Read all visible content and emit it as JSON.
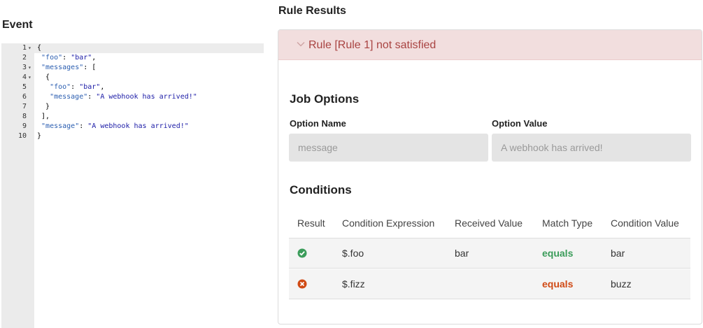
{
  "event": {
    "title": "Event",
    "lines": [
      {
        "n": "1",
        "fold": true,
        "text": "{"
      },
      {
        "n": "2",
        "fold": false,
        "key": "\"foo\"",
        "sep": ": ",
        "val": "\"bar\"",
        "tail": ",",
        "indent": " "
      },
      {
        "n": "3",
        "fold": true,
        "key": "\"messages\"",
        "sep": ": ",
        "val": "",
        "tail": "[",
        "indent": " "
      },
      {
        "n": "4",
        "fold": true,
        "text": "  {"
      },
      {
        "n": "5",
        "fold": false,
        "key": "\"foo\"",
        "sep": ": ",
        "val": "\"bar\"",
        "tail": ",",
        "indent": "   "
      },
      {
        "n": "6",
        "fold": false,
        "key": "\"message\"",
        "sep": ": ",
        "val": "\"A webhook has arrived!\"",
        "tail": "",
        "indent": "   "
      },
      {
        "n": "7",
        "fold": false,
        "text": "  }"
      },
      {
        "n": "8",
        "fold": false,
        "text": " ],"
      },
      {
        "n": "9",
        "fold": false,
        "key": "\"message\"",
        "sep": ": ",
        "val": "\"A webhook has arrived!\"",
        "tail": "",
        "indent": " "
      },
      {
        "n": "10",
        "fold": false,
        "text": "}"
      }
    ]
  },
  "results": {
    "title": "Rule Results",
    "rule_header": "Rule [Rule 1] not satisfied",
    "job_options": {
      "title": "Job Options",
      "name_label": "Option Name",
      "value_label": "Option Value",
      "name_value": "message",
      "value_value": "A webhook has arrived!"
    },
    "conditions": {
      "title": "Conditions",
      "headers": [
        "Result",
        "Condition Expression",
        "Received Value",
        "Match Type",
        "Condition Value"
      ],
      "rows": [
        {
          "status": "pass",
          "icon": "check-circle-icon",
          "expression": "$.foo",
          "received": "bar",
          "match": "equals",
          "value": "bar"
        },
        {
          "status": "fail",
          "icon": "x-circle-icon",
          "expression": "$.fizz",
          "received": "",
          "match": "equals",
          "value": "buzz"
        }
      ]
    }
  },
  "colors": {
    "pass": "#3b9c5a",
    "fail": "#d04a15",
    "danger_bg": "#f2dede",
    "danger_text": "#a94442"
  }
}
